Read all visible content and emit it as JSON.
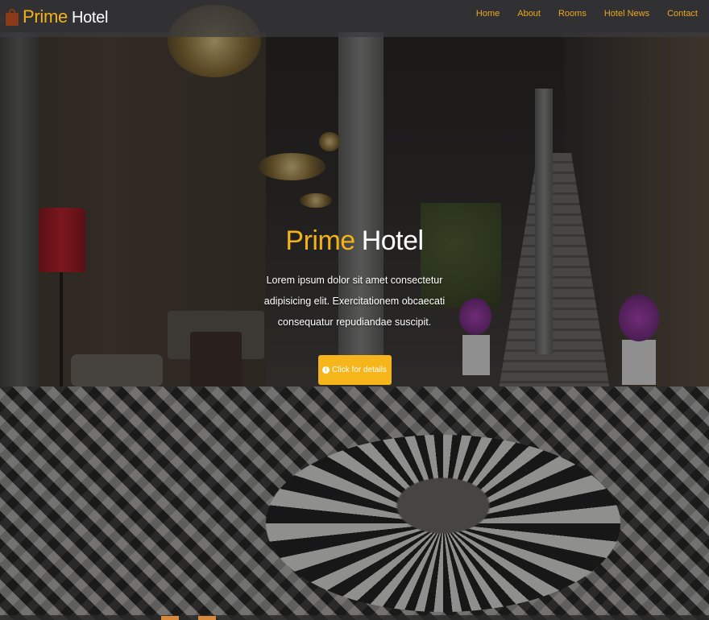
{
  "brand": {
    "word1": "Prime",
    "word2": "Hotel",
    "icon": "shopping-bag-icon"
  },
  "nav": {
    "items": [
      {
        "label": "Home"
      },
      {
        "label": "About"
      },
      {
        "label": "Rooms"
      },
      {
        "label": "Hotel News"
      },
      {
        "label": "Contact"
      }
    ]
  },
  "hero": {
    "title_word1": "Prime",
    "title_word2": "Hotel",
    "description": "Lorem ipsum dolor sit amet consectetur adipisicing elit. Exercitationem obcaecati consequatur repudiandae suscipit.",
    "cta_label": "Click for details",
    "cta_icon": "info-icon"
  },
  "colors": {
    "accent": "#f2b21a",
    "nav_link": "#e9a825",
    "button": "#f6b51a"
  }
}
